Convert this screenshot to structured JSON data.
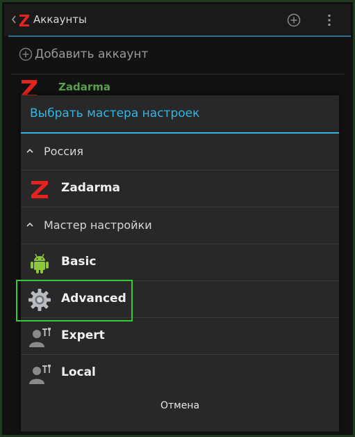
{
  "actionbar": {
    "title": "Аккаунты",
    "add_icon": "add-circle-icon",
    "menu_icon": "overflow-menu-icon"
  },
  "background": {
    "add_account_label": "Добавить аккаунт",
    "account_name": "Zadarma"
  },
  "dialog": {
    "title": "Выбрать мастера настроек",
    "groups": [
      {
        "label": "Россия",
        "items": [
          {
            "label": "Zadarma",
            "icon": "zadarma-logo-icon"
          }
        ]
      },
      {
        "label": "Мастер настройки",
        "items": [
          {
            "label": "Basic",
            "icon": "android-robot-icon"
          },
          {
            "label": "Advanced",
            "icon": "gear-icon"
          },
          {
            "label": "Expert",
            "icon": "user-tools-icon"
          },
          {
            "label": "Local",
            "icon": "user-tools-icon"
          }
        ]
      }
    ],
    "cancel_label": "Отмена"
  },
  "colors": {
    "accent": "#33b5e5",
    "highlight": "#33cc33",
    "brand_red": "#e52420",
    "account_green": "#5aa14c"
  }
}
